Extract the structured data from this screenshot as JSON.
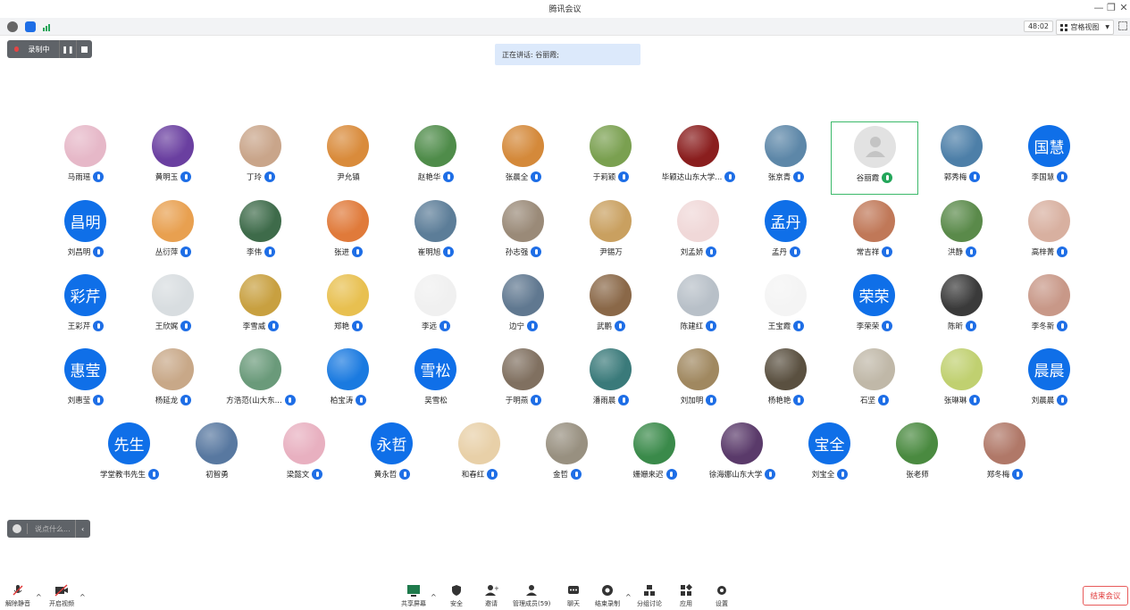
{
  "window": {
    "title": "腾讯会议"
  },
  "status": {
    "timer": "48:02",
    "view_label": "宫格视图"
  },
  "recording": {
    "label": "录制中"
  },
  "speaking": {
    "text": "正在讲话: 谷丽霞;"
  },
  "colors": {
    "accent": "#0f6fe8",
    "active_border": "#3cb96a",
    "end_red": "#e03a3a"
  },
  "participants": [
    {
      "name": "马雨瑶",
      "avatar": "photo",
      "color": "#e6b8c8"
    },
    {
      "name": "黄明玉",
      "avatar": "photo",
      "color": "#6a3fa0"
    },
    {
      "name": "丁玲",
      "avatar": "photo",
      "color": "#c9a58a"
    },
    {
      "name": "尹允镇",
      "avatar": "photo",
      "color": "#d98b3b",
      "muted_hidden": true
    },
    {
      "name": "赵艳华",
      "avatar": "photo",
      "color": "#4f8c4a"
    },
    {
      "name": "张晨全",
      "avatar": "photo",
      "color": "#d4893a"
    },
    {
      "name": "于莉颖",
      "avatar": "photo",
      "color": "#7aa050"
    },
    {
      "name": "毕颖达山东大学...",
      "avatar": "photo",
      "color": "#8a1e1e"
    },
    {
      "name": "张京青",
      "avatar": "photo",
      "color": "#5d87a8"
    },
    {
      "name": "谷丽霞",
      "avatar": "photo",
      "color": "#d6d6d6",
      "active": true
    },
    {
      "name": "郭秀梅",
      "avatar": "photo",
      "color": "#4d7fa8"
    },
    {
      "name": "李国慧",
      "avatar": "text",
      "text": "国慧"
    },
    {
      "name": "刘昌明",
      "avatar": "text",
      "text": "昌明"
    },
    {
      "name": "丛衍萍",
      "avatar": "photo",
      "color": "#e8a050"
    },
    {
      "name": "李伟",
      "avatar": "photo",
      "color": "#3e6b4a"
    },
    {
      "name": "张进",
      "avatar": "photo",
      "color": "#e07a3a"
    },
    {
      "name": "崔明旭",
      "avatar": "photo",
      "color": "#5c7d98"
    },
    {
      "name": "孙志强",
      "avatar": "photo",
      "color": "#9a8a78"
    },
    {
      "name": "尹锡万",
      "avatar": "photo",
      "color": "#c9a060",
      "muted_hidden": true
    },
    {
      "name": "刘孟娇",
      "avatar": "photo",
      "color": "#f0d8d8"
    },
    {
      "name": "孟丹",
      "avatar": "text",
      "text": "孟丹"
    },
    {
      "name": "常吉祥",
      "avatar": "photo",
      "color": "#c07858"
    },
    {
      "name": "洪静",
      "avatar": "photo",
      "color": "#5a8a4a"
    },
    {
      "name": "高梓菁",
      "avatar": "photo",
      "color": "#d8b0a0"
    },
    {
      "name": "王彩芹",
      "avatar": "text",
      "text": "彩芹"
    },
    {
      "name": "王欣娓",
      "avatar": "photo",
      "color": "#d8dde0"
    },
    {
      "name": "李雪威",
      "avatar": "photo",
      "color": "#c8a040"
    },
    {
      "name": "郑艳",
      "avatar": "photo",
      "color": "#e8c050"
    },
    {
      "name": "李远",
      "avatar": "photo",
      "color": "#f0f0f0"
    },
    {
      "name": "边宁",
      "avatar": "photo",
      "color": "#607890"
    },
    {
      "name": "武鹏",
      "avatar": "photo",
      "color": "#8a6848"
    },
    {
      "name": "陈建红",
      "avatar": "photo",
      "color": "#b8c0c8"
    },
    {
      "name": "王宝霞",
      "avatar": "photo",
      "color": "#f4f4f4"
    },
    {
      "name": "李荣荣",
      "avatar": "text",
      "text": "荣荣"
    },
    {
      "name": "陈昕",
      "avatar": "photo",
      "color": "#3a3a3a"
    },
    {
      "name": "李冬新",
      "avatar": "photo",
      "color": "#c89888"
    },
    {
      "name": "刘惠莹",
      "avatar": "text",
      "text": "惠莹"
    },
    {
      "name": "杨延龙",
      "avatar": "photo",
      "color": "#c8a888"
    },
    {
      "name": "方浩范(山大东...",
      "avatar": "photo",
      "color": "#6a9a7a"
    },
    {
      "name": "柏宝涛",
      "avatar": "photo",
      "color": "#1a7ae0"
    },
    {
      "name": "吴雪松",
      "avatar": "text",
      "text": "雪松",
      "muted_hidden": true
    },
    {
      "name": "于明燕",
      "avatar": "photo",
      "color": "#807060"
    },
    {
      "name": "潘雨晨",
      "avatar": "photo",
      "color": "#3a7a7a"
    },
    {
      "name": "刘加明",
      "avatar": "photo",
      "color": "#a08860"
    },
    {
      "name": "杨艳艳",
      "avatar": "photo",
      "color": "#5a5040"
    },
    {
      "name": "石坚",
      "avatar": "photo",
      "color": "#c0b8a8"
    },
    {
      "name": "张琳琳",
      "avatar": "photo",
      "color": "#c0d070"
    },
    {
      "name": "刘晨晨",
      "avatar": "text",
      "text": "晨晨"
    },
    {
      "name": "学堂教书先生",
      "avatar": "text",
      "text": "先生"
    },
    {
      "name": "初智勇",
      "avatar": "photo",
      "color": "#5878a0",
      "muted_hidden": true
    },
    {
      "name": "梁懿文",
      "avatar": "photo",
      "color": "#e8b0c0"
    },
    {
      "name": "黄永哲",
      "avatar": "text",
      "text": "永哲"
    },
    {
      "name": "和春红",
      "avatar": "photo",
      "color": "#e8d0a8"
    },
    {
      "name": "金哲",
      "avatar": "photo",
      "color": "#989080"
    },
    {
      "name": "姗姗来迟",
      "avatar": "photo",
      "color": "#3a8a4a"
    },
    {
      "name": "徐海娜山东大学",
      "avatar": "photo",
      "color": "#5a3a6a"
    },
    {
      "name": "刘宝全",
      "avatar": "text",
      "text": "宝全"
    },
    {
      "name": "张老师",
      "avatar": "photo",
      "color": "#4a8a40",
      "muted_hidden": true
    },
    {
      "name": "郑冬梅",
      "avatar": "photo",
      "color": "#b07868"
    }
  ],
  "chat": {
    "placeholder": "说点什么..."
  },
  "toolbar": {
    "unmute": "解除静音",
    "video": "开启视频",
    "share": "共享屏幕",
    "security": "安全",
    "invite": "邀请",
    "members": "管理成员(59)",
    "chat": "聊天",
    "end_record": "结束录制",
    "breakout": "分组讨论",
    "apps": "应用",
    "settings": "设置",
    "end_meeting": "结束会议"
  }
}
